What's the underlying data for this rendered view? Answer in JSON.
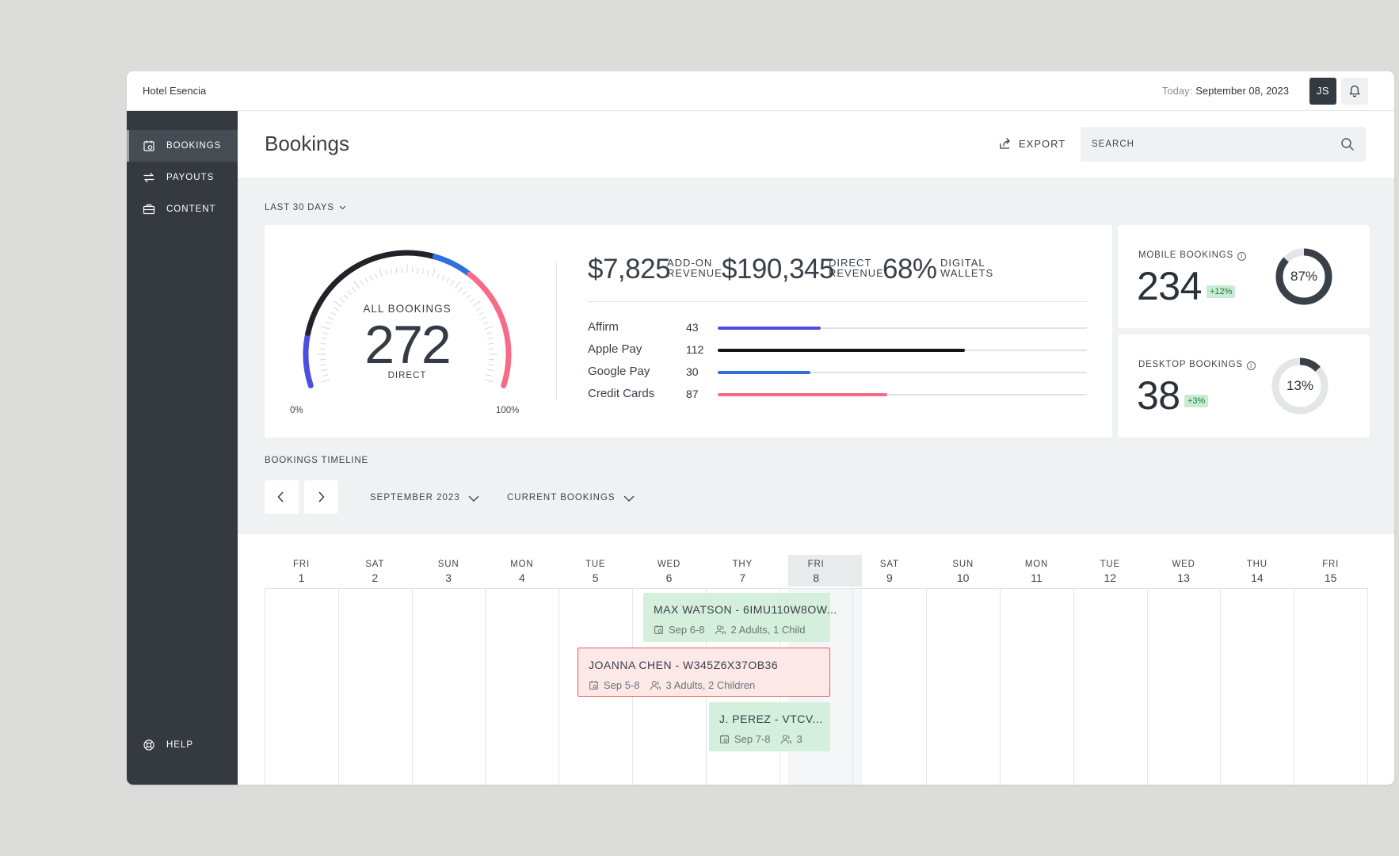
{
  "topbar": {
    "hotel_name": "Hotel Esencia",
    "today_label": "Today:",
    "today_date": "September 08, 2023",
    "avatar_initials": "JS"
  },
  "sidebar": {
    "items": [
      {
        "label": "BOOKINGS",
        "icon": "calendar-icon",
        "active": true
      },
      {
        "label": "PAYOUTS",
        "icon": "swap-arrows-icon",
        "active": false
      },
      {
        "label": "CONTENT",
        "icon": "briefcase-icon",
        "active": false
      }
    ],
    "help_label": "HELP"
  },
  "header": {
    "title": "Bookings",
    "export_label": "EXPORT",
    "search_placeholder": "SEARCH"
  },
  "filters": {
    "range": "LAST 30 DAYS"
  },
  "overview": {
    "gauge": {
      "top_label": "ALL BOOKINGS",
      "value": "272",
      "bottom_label": "DIRECT",
      "min_label": "0%",
      "max_label": "100%",
      "colors": [
        "#4b4fe0",
        "#202428",
        "#2f6fe0",
        "#f76b86"
      ]
    },
    "stats": [
      {
        "value": "$7,825",
        "label_line1": "ADD-ON",
        "label_line2": "REVENUE"
      },
      {
        "value": "$190,345",
        "label_line1": "DIRECT",
        "label_line2": "REVENUE"
      },
      {
        "value": "68%",
        "label_line1": "DIGITAL",
        "label_line2": "WALLETS"
      }
    ],
    "payments": [
      {
        "name": "Affirm",
        "count": "43",
        "fraction": 0.28,
        "color": "#4b4fe0"
      },
      {
        "name": "Apple Pay",
        "count": "112",
        "fraction": 0.67,
        "color": "#111418"
      },
      {
        "name": "Google Pay",
        "count": "30",
        "fraction": 0.25,
        "color": "#2f6fe0"
      },
      {
        "name": "Credit Cards",
        "count": "87",
        "fraction": 0.46,
        "color": "#f76b86"
      }
    ]
  },
  "mobile": {
    "label": "MOBILE BOOKINGS",
    "value": "234",
    "change": "+12%",
    "percent_label": "87%",
    "fraction": 0.87
  },
  "desktop": {
    "label": "DESKTOP BOOKINGS",
    "value": "38",
    "change": "+3%",
    "percent_label": "13%",
    "fraction": 0.13
  },
  "timeline": {
    "title": "BOOKINGS TIMELINE",
    "month": "SEPTEMBER 2023",
    "view": "CURRENT BOOKINGS",
    "days": [
      {
        "dow": "FRI",
        "day": "1"
      },
      {
        "dow": "SAT",
        "day": "2"
      },
      {
        "dow": "SUN",
        "day": "3"
      },
      {
        "dow": "MON",
        "day": "4"
      },
      {
        "dow": "TUE",
        "day": "5"
      },
      {
        "dow": "WED",
        "day": "6"
      },
      {
        "dow": "THY",
        "day": "7"
      },
      {
        "dow": "FRI",
        "day": "8"
      },
      {
        "dow": "SAT",
        "day": "9"
      },
      {
        "dow": "SUN",
        "day": "10"
      },
      {
        "dow": "MON",
        "day": "11"
      },
      {
        "dow": "TUE",
        "day": "12"
      },
      {
        "dow": "WED",
        "day": "13"
      },
      {
        "dow": "THU",
        "day": "14"
      },
      {
        "dow": "FRI",
        "day": "15"
      }
    ],
    "bookings": [
      {
        "name": "MAX WATSON - 6IMU110W8OW...",
        "dates": "Sep 6-8",
        "guests": "2 Adults, 1 Child",
        "status": "green"
      },
      {
        "name": "JOANNA CHEN - W345Z6X37OB36",
        "dates": "Sep 5-8",
        "guests": "3 Adults, 2 Children",
        "status": "red"
      },
      {
        "name": "J. PEREZ - VTCV...",
        "dates": "Sep 7-8",
        "guests": "3",
        "status": "green"
      }
    ]
  }
}
